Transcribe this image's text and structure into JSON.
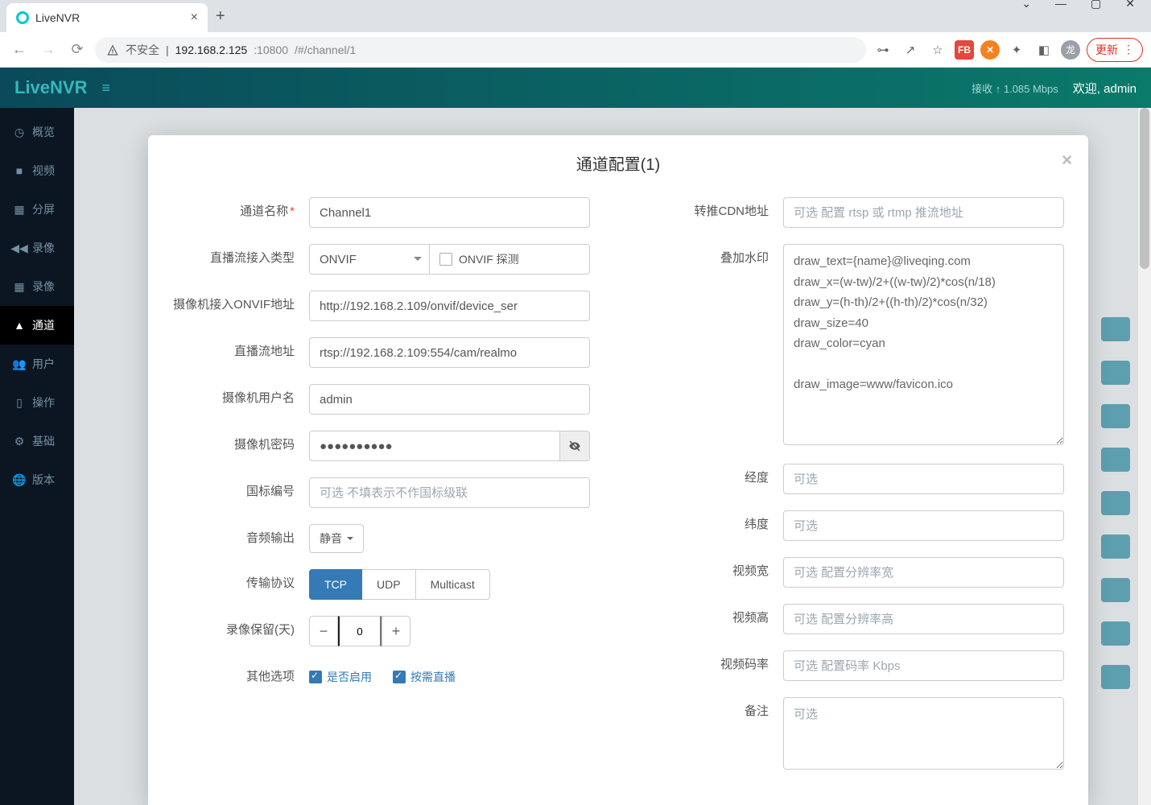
{
  "browser": {
    "tab_title": "LiveNVR",
    "url_insecure": "不安全",
    "url_host": "192.168.2.125",
    "url_port": ":10800",
    "url_path": "/#/channel/1",
    "update_label": "更新",
    "avatar_letter": "龙"
  },
  "header": {
    "brand": "LiveNVR",
    "stat_recv_label": "接收",
    "stat_recv_value": "1.085 Mbps",
    "welcome_prefix": "欢迎,",
    "welcome_user": "admin"
  },
  "sidebar": {
    "items": [
      {
        "label": "概览"
      },
      {
        "label": "视频"
      },
      {
        "label": "分屏"
      },
      {
        "label": "录像"
      },
      {
        "label": "录像"
      },
      {
        "label": "通道"
      },
      {
        "label": "用户"
      },
      {
        "label": "操作"
      },
      {
        "label": "基础"
      },
      {
        "label": "版本"
      }
    ]
  },
  "modal": {
    "title": "通道配置(1)"
  },
  "left": {
    "name_label": "通道名称",
    "name_value": "Channel1",
    "access_type_label": "直播流接入类型",
    "access_type_value": "ONVIF",
    "onvif_probe_label": "ONVIF 探测",
    "onvif_addr_label": "摄像机接入ONVIF地址",
    "onvif_addr_value": "http://192.168.2.109/onvif/device_ser",
    "stream_addr_label": "直播流地址",
    "stream_addr_value": "rtsp://192.168.2.109:554/cam/realmo",
    "cam_user_label": "摄像机用户名",
    "cam_user_value": "admin",
    "cam_pw_label": "摄像机密码",
    "cam_pw_value": "●●●●●●●●●●",
    "gb_label": "国标编号",
    "gb_placeholder": "可选 不填表示不作国标级联",
    "audio_label": "音频输出",
    "audio_value": "静音",
    "transport_label": "传输协议",
    "transport_opts": [
      "TCP",
      "UDP",
      "Multicast"
    ],
    "transport_selected": "TCP",
    "record_keep_label": "录像保留(天)",
    "record_keep_value": "0",
    "other_label": "其他选项",
    "chk_enable": "是否启用",
    "chk_ondemand": "按需直播"
  },
  "right": {
    "cdn_label": "转推CDN地址",
    "cdn_placeholder": "可选 配置 rtsp 或 rtmp 推流地址",
    "watermark_label": "叠加水印",
    "watermark_value": "draw_text={name}@liveqing.com\ndraw_x=(w-tw)/2+((w-tw)/2)*cos(n/18)\ndraw_y=(h-th)/2+((h-th)/2)*cos(n/32)\ndraw_size=40\ndraw_color=cyan\n\ndraw_image=www/favicon.ico",
    "lng_label": "经度",
    "lat_label": "纬度",
    "opt_placeholder": "可选",
    "vw_label": "视频宽",
    "vw_placeholder": "可选 配置分辨率宽",
    "vh_label": "视频高",
    "vh_placeholder": "可选 配置分辨率高",
    "br_label": "视频码率",
    "br_placeholder": "可选 配置码率 Kbps",
    "remark_label": "备注",
    "remark_placeholder": "可选"
  }
}
